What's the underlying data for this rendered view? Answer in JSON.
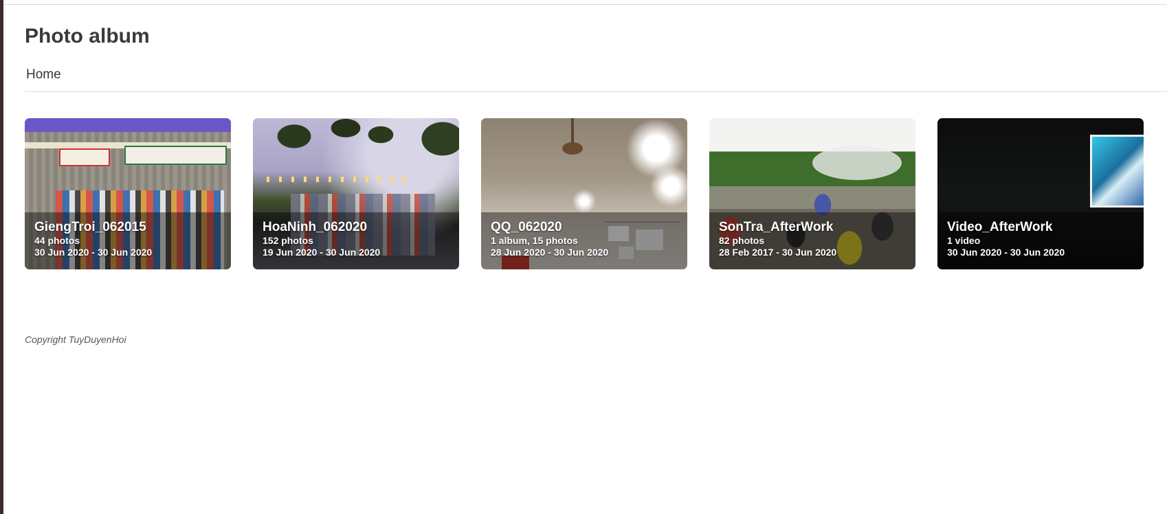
{
  "page": {
    "title": "Photo album",
    "breadcrumb": "Home",
    "footer": "Copyright TuyDuyenHoi"
  },
  "albums": [
    {
      "title": "GiengTroi_062015",
      "count": "44 photos",
      "dates": "30 Jun 2020 - 30 Jun 2020"
    },
    {
      "title": "HoaNinh_062020",
      "count": "152 photos",
      "dates": "19 Jun 2020 - 30 Jun 2020"
    },
    {
      "title": "QQ_062020",
      "count": "1 album, 15 photos",
      "dates": "28 Jun 2020 - 30 Jun 2020"
    },
    {
      "title": "SonTra_AfterWork",
      "count": "82 photos",
      "dates": "28 Feb 2017 - 30 Jun 2020"
    },
    {
      "title": "Video_AfterWork",
      "count": "1 video",
      "dates": "30 Jun 2020 - 30 Jun 2020"
    }
  ]
}
